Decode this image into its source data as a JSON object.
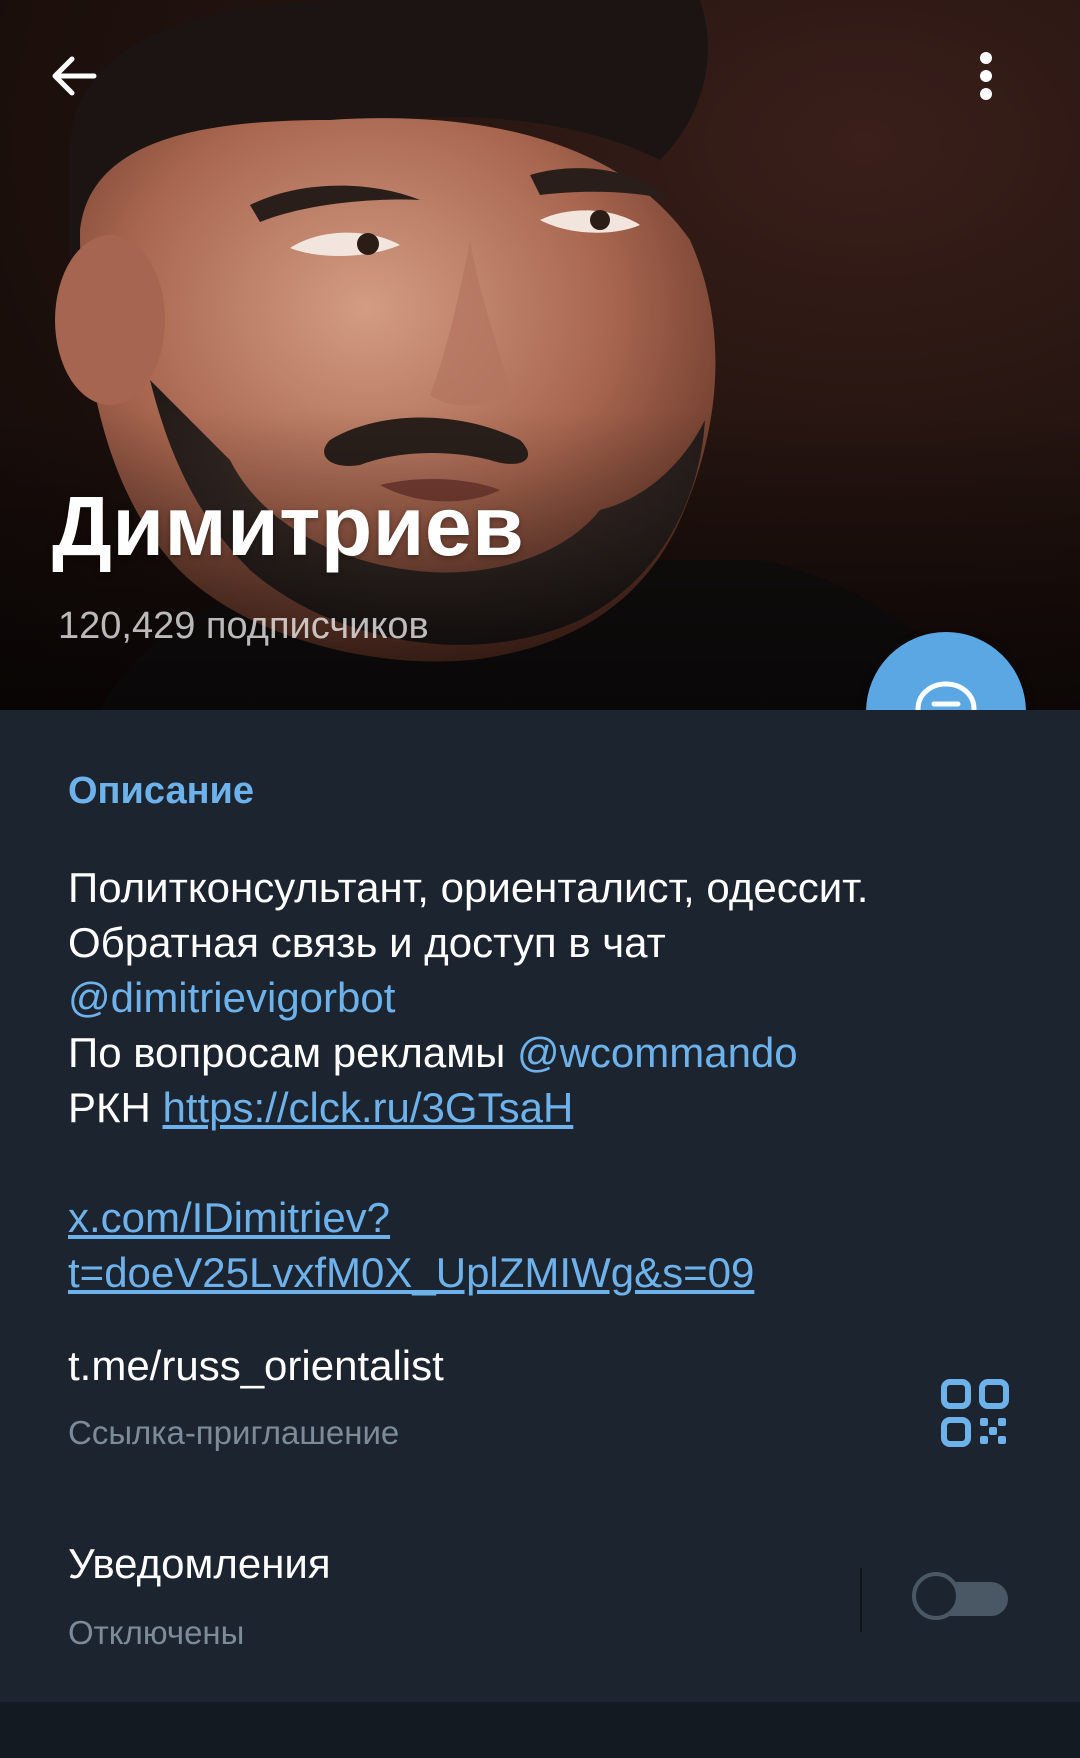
{
  "header": {
    "channel_name": "Димитриев",
    "subscribers": "120,429 подписчиков",
    "back_icon": "arrow-left-icon",
    "menu_icon": "more-vertical-icon"
  },
  "fab": {
    "icon": "chat-bubble-icon"
  },
  "description": {
    "title": "Описание",
    "line1": "Политконсультант, ориенталист, одессит.",
    "line2": "Обратная связь и доступ в чат",
    "mention_bot": "@dimitrievigorbot",
    "ads_prefix": "По вопросам рекламы ",
    "mention_ads": "@wcommando",
    "rkn_prefix": "РКН ",
    "rkn_url": "https://clck.ru/3GTsaH",
    "x_url_line1": "x.com/IDimitriev?",
    "x_url_line2": "t=doeV25LvxfM0X_UplZMIWg&s=09"
  },
  "invite": {
    "link": "t.me/russ_orientalist",
    "caption": "Ссылка-приглашение",
    "icon": "qr-code-icon"
  },
  "notifications": {
    "title": "Уведомления",
    "status": "Отключены",
    "enabled": false
  },
  "colors": {
    "background": "#1c242f",
    "accent": "#6eb2ec",
    "fab": "#5aa7e3",
    "secondary_text": "#7d8b99"
  }
}
